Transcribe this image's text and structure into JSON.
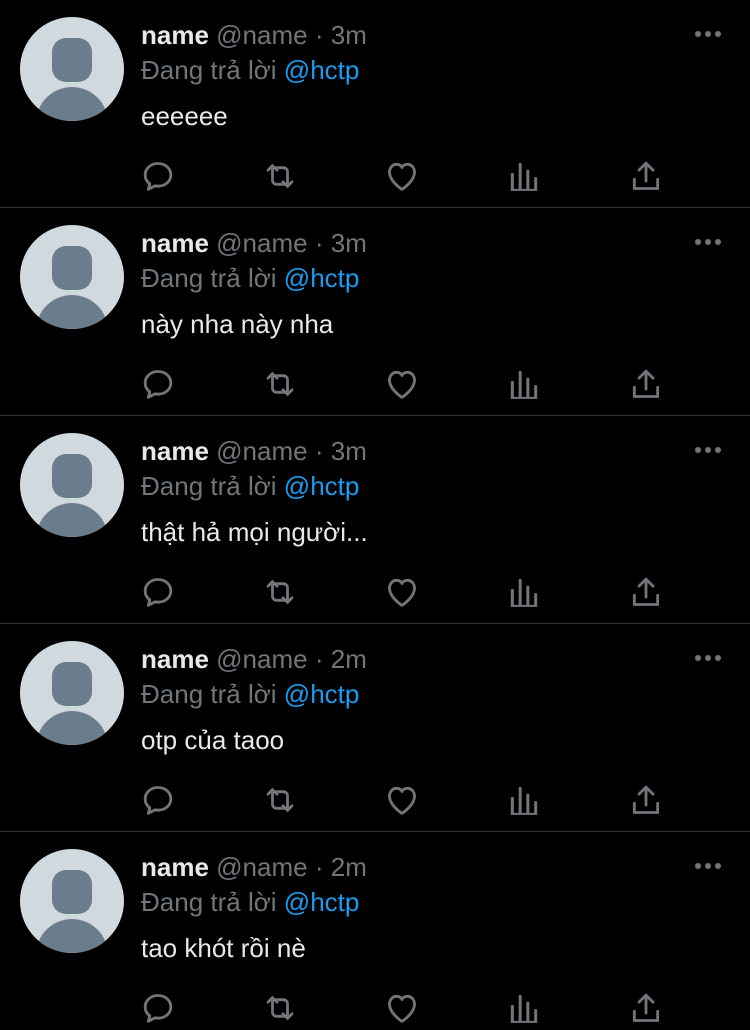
{
  "theme": {
    "background": "#000000",
    "text": "#e7e9ea",
    "muted": "#71767b",
    "accent": "#1d9bf0",
    "divider": "#2f3336",
    "avatar_bg": "#cfd9de",
    "avatar_fg": "#697d8c"
  },
  "icons": [
    "more-icon",
    "reply-icon",
    "retweet-icon",
    "like-icon",
    "analytics-icon",
    "share-icon"
  ],
  "tweets": [
    {
      "display_name": "name",
      "handle": "@name",
      "separator": "·",
      "time": "3m",
      "reply_prefix": "Đang trả lời",
      "reply_to": "@hctp",
      "text": "eeeeee"
    },
    {
      "display_name": "name",
      "handle": "@name",
      "separator": "·",
      "time": "3m",
      "reply_prefix": "Đang trả lời",
      "reply_to": "@hctp",
      "text": "này nha này nha"
    },
    {
      "display_name": "name",
      "handle": "@name",
      "separator": "·",
      "time": "3m",
      "reply_prefix": "Đang trả lời",
      "reply_to": "@hctp",
      "text": "thật hả mọi người..."
    },
    {
      "display_name": "name",
      "handle": "@name",
      "separator": "·",
      "time": "2m",
      "reply_prefix": "Đang trả lời",
      "reply_to": "@hctp",
      "text": "otp của taoo"
    },
    {
      "display_name": "name",
      "handle": "@name",
      "separator": "·",
      "time": "2m",
      "reply_prefix": "Đang trả lời",
      "reply_to": "@hctp",
      "text": "tao khót rồi nè"
    }
  ]
}
